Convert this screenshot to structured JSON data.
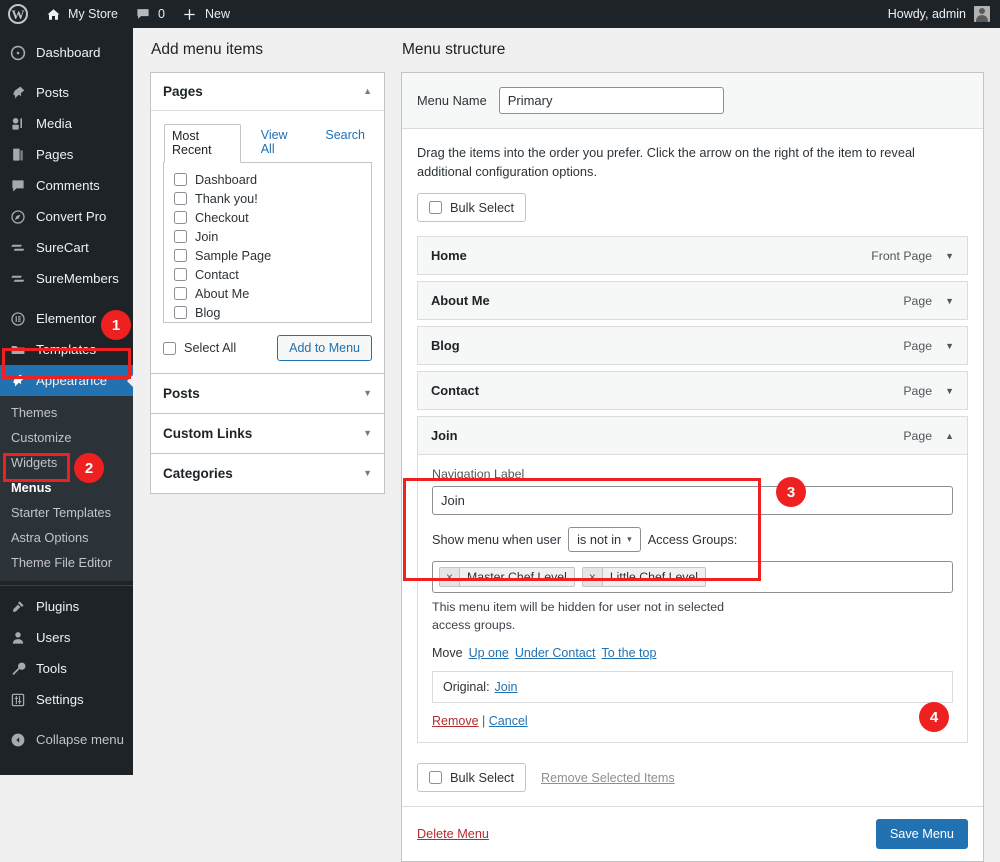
{
  "adminbar": {
    "wp_logo": "wordpress-logo",
    "site_name": "My Store",
    "comment_count": "0",
    "new_label": "New",
    "howdy": "Howdy, admin"
  },
  "sidebar": {
    "items": [
      {
        "label": "Dashboard",
        "icon": "dashboard-icon"
      },
      {
        "label": "Posts",
        "icon": "pin-icon"
      },
      {
        "label": "Media",
        "icon": "media-icon"
      },
      {
        "label": "Pages",
        "icon": "pages-icon"
      },
      {
        "label": "Comments",
        "icon": "comments-icon"
      },
      {
        "label": "Convert Pro",
        "icon": "convert-pro-icon"
      },
      {
        "label": "SureCart",
        "icon": "surecart-icon"
      },
      {
        "label": "SureMembers",
        "icon": "suremembers-icon"
      },
      {
        "label": "Elementor",
        "icon": "elementor-icon"
      },
      {
        "label": "Templates",
        "icon": "templates-folder-icon"
      },
      {
        "label": "Appearance",
        "icon": "appearance-brush-icon"
      }
    ],
    "appearance_submenu": [
      {
        "label": "Themes"
      },
      {
        "label": "Customize"
      },
      {
        "label": "Widgets"
      },
      {
        "label": "Menus"
      },
      {
        "label": "Starter Templates"
      },
      {
        "label": "Astra Options"
      },
      {
        "label": "Theme File Editor"
      }
    ],
    "items_after": [
      {
        "label": "Plugins",
        "icon": "plugins-icon"
      },
      {
        "label": "Users",
        "icon": "users-icon"
      },
      {
        "label": "Tools",
        "icon": "tools-wrench-icon"
      },
      {
        "label": "Settings",
        "icon": "settings-sliders-icon"
      },
      {
        "label": "Collapse menu",
        "icon": "collapse-arrow-icon"
      }
    ]
  },
  "add_menu_items": {
    "heading": "Add menu items",
    "pages": {
      "title": "Pages",
      "tabs": [
        {
          "label": "Most Recent",
          "active": true
        },
        {
          "label": "View All",
          "active": false
        },
        {
          "label": "Search",
          "active": false
        }
      ],
      "items": [
        "Dashboard",
        "Thank you!",
        "Checkout",
        "Join",
        "Sample Page",
        "Contact",
        "About Me",
        "Blog"
      ],
      "select_all": "Select All",
      "add_to_menu": "Add to Menu"
    },
    "accordions": [
      {
        "title": "Posts"
      },
      {
        "title": "Custom Links"
      },
      {
        "title": "Categories"
      }
    ]
  },
  "menu_structure": {
    "heading": "Menu structure",
    "menu_name_label": "Menu Name",
    "menu_name_value": "Primary",
    "menu_name_placeholder": "Menu Name",
    "instructions": "Drag the items into the order you prefer. Click the arrow on the right of the item to reveal additional configuration options.",
    "bulk_select_top": "Bulk Select",
    "items": [
      {
        "title": "Home",
        "type": "Front Page",
        "open": false
      },
      {
        "title": "About Me",
        "type": "Page",
        "open": false
      },
      {
        "title": "Blog",
        "type": "Page",
        "open": false
      },
      {
        "title": "Contact",
        "type": "Page",
        "open": false
      },
      {
        "title": "Join",
        "type": "Page",
        "open": true
      }
    ],
    "open_item": {
      "nav_label_label": "Navigation Label",
      "nav_label_value": "Join",
      "show_menu_prefix": "Show menu when user",
      "condition_value": "is not in",
      "access_groups_label": "Access Groups:",
      "tokens": [
        {
          "remove": "×",
          "label": "Master Chef Level"
        },
        {
          "remove": "×",
          "label": "Little Chef Level"
        }
      ],
      "hint": "This menu item will be hidden for user not in selected access groups.",
      "move_label": "Move",
      "move_links": [
        "Up one",
        "Under Contact",
        "To the top"
      ],
      "original_label": "Original:",
      "original_value": "Join",
      "remove_link": "Remove",
      "separator": "|",
      "cancel_link": "Cancel"
    },
    "bulk_select_bottom": "Bulk Select",
    "remove_selected": "Remove Selected Items",
    "delete_menu": "Delete Menu",
    "save_menu": "Save Menu"
  },
  "annotations": {
    "badges": [
      {
        "number": "1"
      },
      {
        "number": "2"
      },
      {
        "number": "3"
      },
      {
        "number": "4"
      }
    ],
    "accent_color": "#ee2020"
  }
}
